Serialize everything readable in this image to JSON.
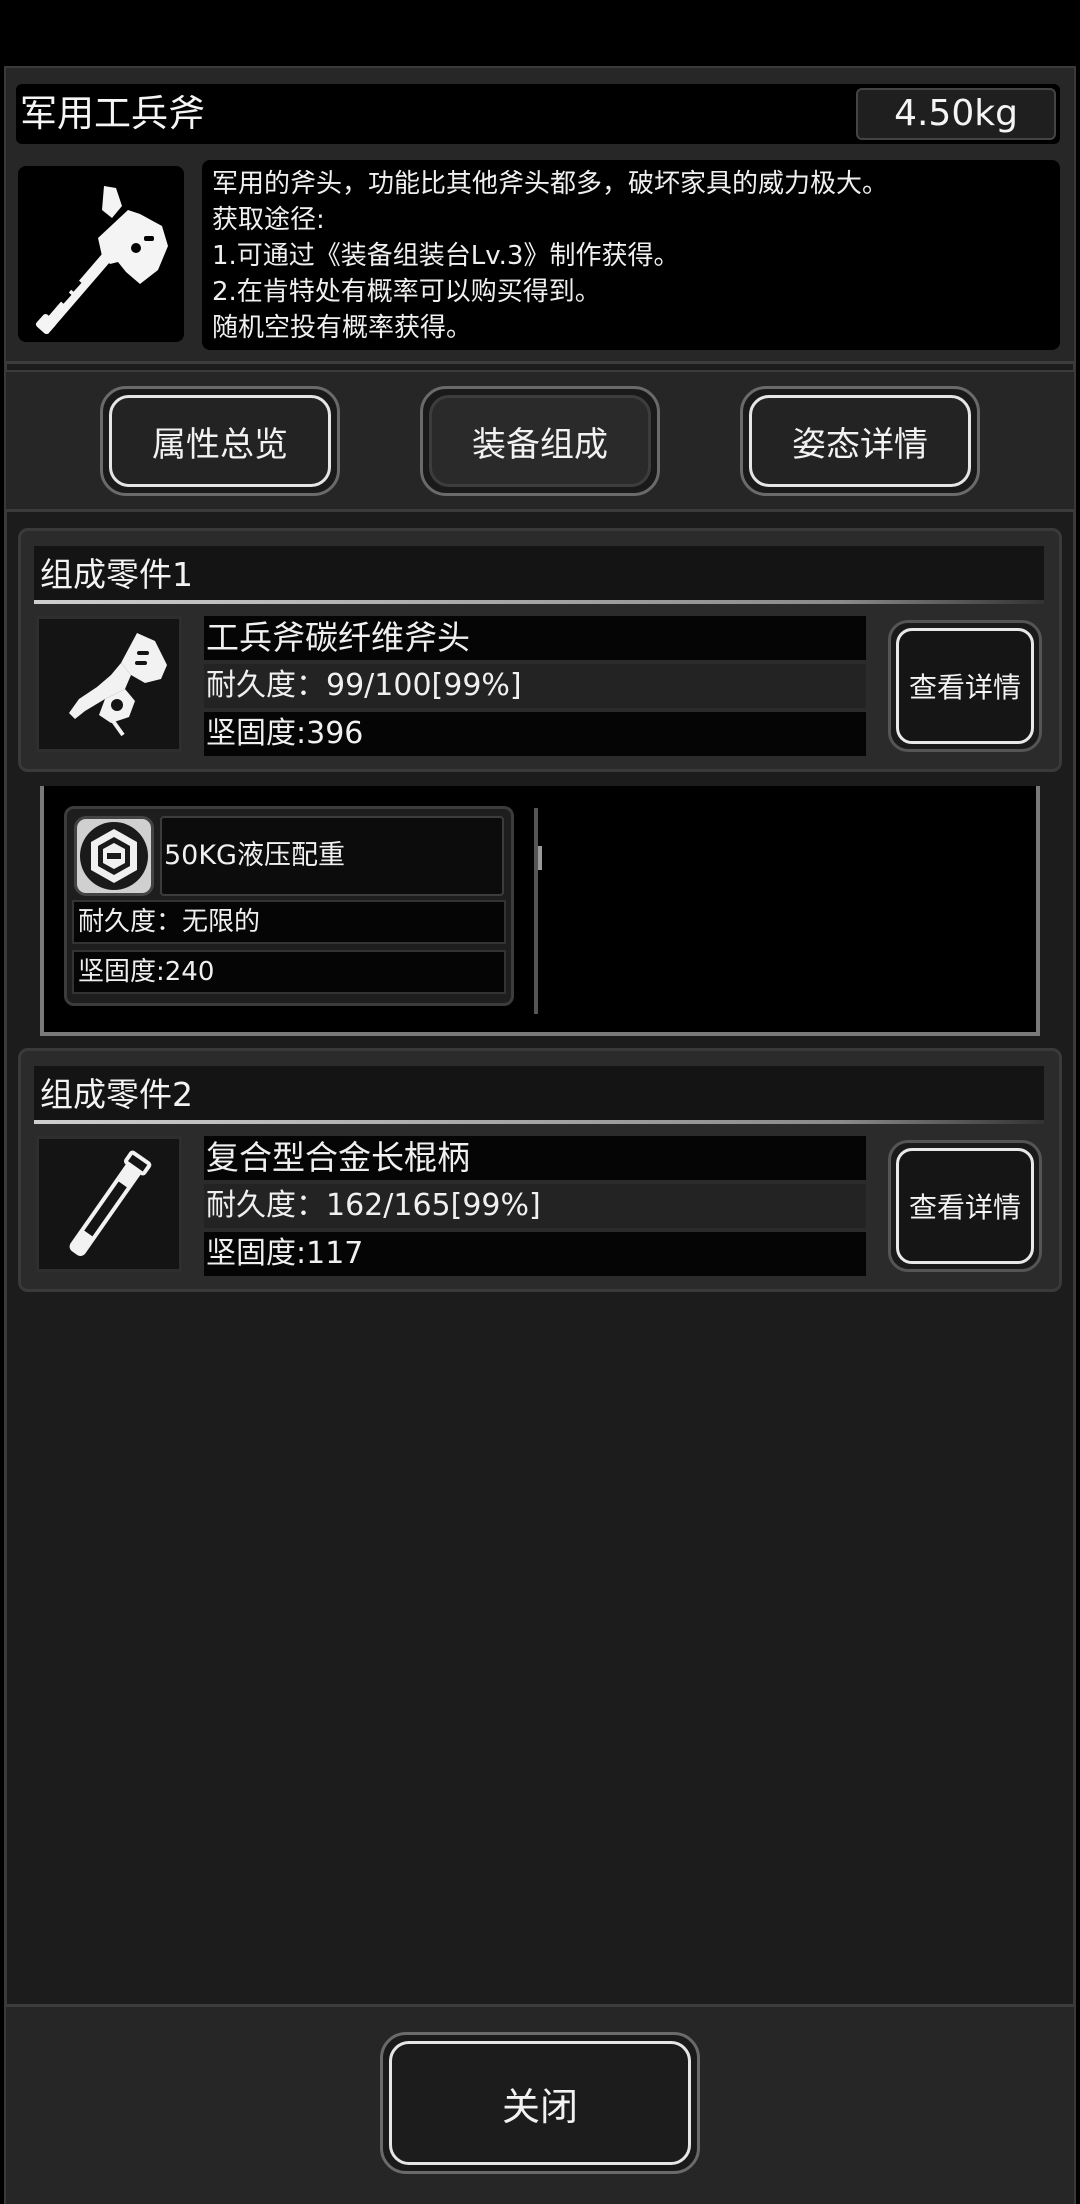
{
  "item": {
    "name": "军用工兵斧",
    "weight": "4.50kg",
    "description_lines": [
      "军用的斧头，功能比其他斧头都多，破坏家具的威力极大。",
      "获取途径:",
      "1.可通过《装备组装台Lv.3》制作获得。",
      "2.在肯特处有概率可以购买得到。",
      "随机空投有概率获得。"
    ]
  },
  "tabs": [
    {
      "label": "属性总览",
      "active": false
    },
    {
      "label": "装备组成",
      "active": true
    },
    {
      "label": "姿态详情",
      "active": false
    }
  ],
  "parts": [
    {
      "header": "组成零件1",
      "icon": "axe-head-icon",
      "name": "工兵斧碳纤维斧头",
      "durability": "耐久度：99/100[99%]",
      "firmness": "坚固度:396",
      "detail_label": "查看详情",
      "sub_parts": [
        {
          "icon": "hexagon-weight-icon",
          "name": "50KG液压配重",
          "durability": "耐久度：无限的",
          "firmness": "坚固度:240"
        }
      ]
    },
    {
      "header": "组成零件2",
      "icon": "handle-icon",
      "name": "复合型合金长棍柄",
      "durability": "耐久度：162/165[99%]",
      "firmness": "坚固度:117",
      "detail_label": "查看详情"
    }
  ],
  "close_label": "关闭"
}
